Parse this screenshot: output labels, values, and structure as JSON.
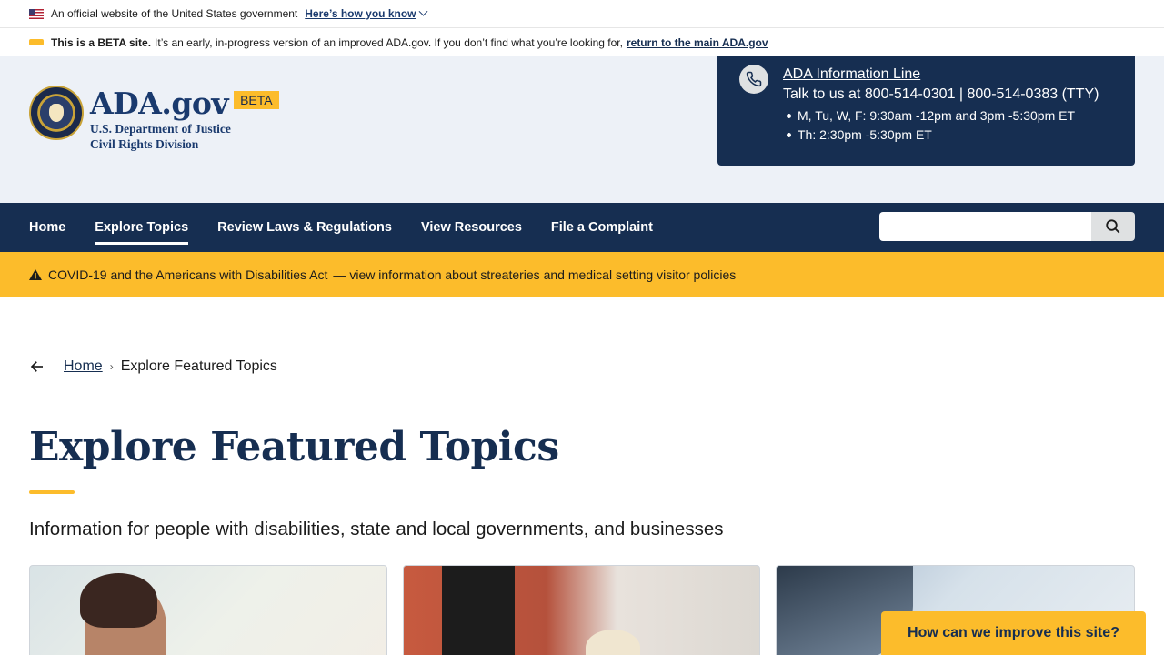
{
  "gov_banner": {
    "text": "An official website of the United States government",
    "link": "Here’s how you know"
  },
  "beta_bar": {
    "bold": "This is a BETA site.",
    "text": "It’s an early, in-progress version of an improved ADA.gov. If you don’t find what you’re looking for,",
    "link": "return to the main ADA.gov"
  },
  "header": {
    "site_name": "ADA.gov",
    "beta_tag": "BETA",
    "dept_line1": "U.S. Department of Justice",
    "dept_line2": "Civil Rights Division"
  },
  "info_line": {
    "title": "ADA Information Line",
    "talk": "Talk to us at 800-514-0301 | 800-514-0383 (TTY)",
    "hours": [
      "M, Tu, W, F: 9:30am -12pm and 3pm -5:30pm ET",
      "Th: 2:30pm -5:30pm ET"
    ]
  },
  "nav": {
    "items": [
      "Home",
      "Explore Topics",
      "Review Laws & Regulations",
      "View Resources",
      "File a Complaint"
    ],
    "active_index": 1,
    "search_placeholder": ""
  },
  "alert": {
    "title": "COVID-19 and the Americans with Disabilities Act",
    "text": "view information about streateries and medical setting visitor policies"
  },
  "breadcrumb": {
    "home": "Home",
    "current": "Explore Featured Topics"
  },
  "page": {
    "title": "Explore Featured Topics",
    "subtitle": "Information for people with disabilities, state and local governments, and businesses"
  },
  "feedback": {
    "label": "How can we improve this site?"
  },
  "colors": {
    "navy": "#162e51",
    "gold": "#fcbc2b",
    "header_bg": "#edf1f7"
  }
}
